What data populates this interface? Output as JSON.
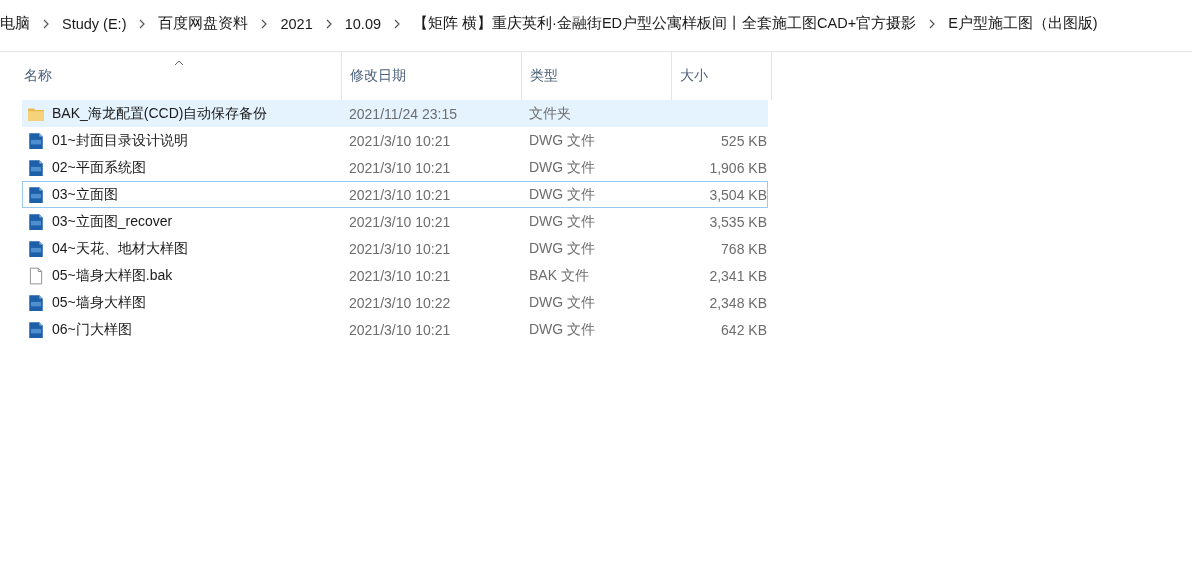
{
  "breadcrumb": [
    "电脑",
    "Study (E:)",
    "百度网盘资料",
    "2021",
    "10.09",
    "【矩阵 横】重庆英利·金融街ED户型公寓样板间丨全套施工图CAD+官方摄影",
    "E户型施工图（出图版)"
  ],
  "columns": [
    {
      "label": "名称",
      "sorted": true
    },
    {
      "label": "修改日期",
      "sorted": false
    },
    {
      "label": "类型",
      "sorted": false
    },
    {
      "label": "大小",
      "sorted": false
    }
  ],
  "rows": [
    {
      "kind": "folder",
      "name": "BAK_海龙配置(CCD)自动保存备份",
      "date": "2021/11/24 23:15",
      "type": "文件夹",
      "selected": true,
      "focused": false
    },
    {
      "kind": "cad",
      "name": "01~封面目录设计说明",
      "date": "2021/3/10 10:21",
      "type": "DWG 文件",
      "size": "525 KB",
      "selected": false,
      "focused": false
    },
    {
      "kind": "cad",
      "name": "02~平面系统图",
      "date": "2021/3/10 10:21",
      "type": "DWG 文件",
      "size": "1,906 KB",
      "selected": false,
      "focused": false
    },
    {
      "kind": "cad",
      "name": "03~立面图",
      "date": "2021/3/10 10:21",
      "type": "DWG 文件",
      "size": "3,504 KB",
      "selected": false,
      "focused": true
    },
    {
      "kind": "cad",
      "name": "03~立面图_recover",
      "date": "2021/3/10 10:21",
      "type": "DWG 文件",
      "size": "3,535 KB",
      "selected": false,
      "focused": false
    },
    {
      "kind": "cad",
      "name": "04~天花、地材大样图",
      "date": "2021/3/10 10:21",
      "type": "DWG 文件",
      "size": "768 KB",
      "selected": false,
      "focused": false
    },
    {
      "kind": "file",
      "name": "05~墙身大样图.bak",
      "date": "2021/3/10 10:21",
      "type": "BAK 文件",
      "size": "2,341 KB",
      "selected": false,
      "focused": false
    },
    {
      "kind": "cad",
      "name": "05~墙身大样图",
      "date": "2021/3/10 10:22",
      "type": "DWG 文件",
      "size": "2,348 KB",
      "selected": false,
      "focused": false
    },
    {
      "kind": "cad",
      "name": "06~门大样图",
      "date": "2021/3/10 10:21",
      "type": "DWG 文件",
      "size": "642 KB",
      "selected": false,
      "focused": false
    }
  ]
}
